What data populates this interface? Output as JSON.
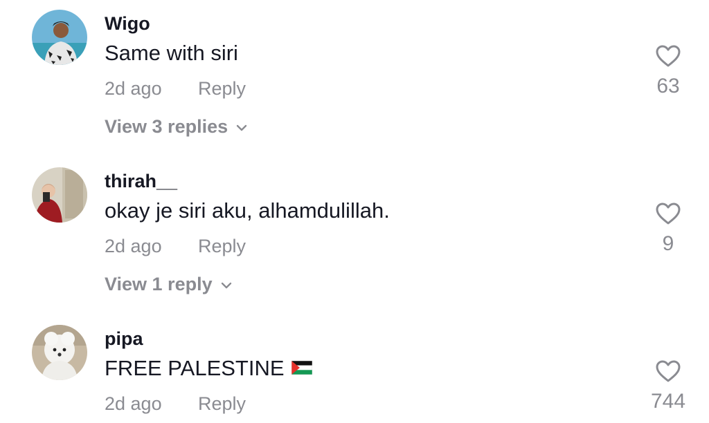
{
  "comments": [
    {
      "username": "Wigo",
      "text": "Same with siri",
      "time": "2d ago",
      "reply_label": "Reply",
      "likes": "63",
      "view_replies": "View 3 replies"
    },
    {
      "username": "thirah__",
      "text": "okay je siri aku, alhamdulillah.",
      "time": "2d ago",
      "reply_label": "Reply",
      "likes": "9",
      "view_replies": "View 1 reply"
    },
    {
      "username": "pipa",
      "text": "FREE PALESTINE",
      "flag_icon": "palestine-flag-icon",
      "time": "2d ago",
      "reply_label": "Reply",
      "likes": "744"
    }
  ],
  "colors": {
    "primary_text": "#161823",
    "secondary_text": "#8a8b91"
  }
}
